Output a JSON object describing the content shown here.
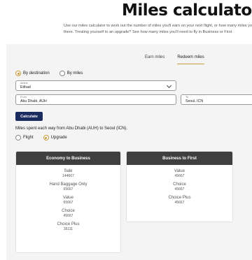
{
  "header": {
    "title": "Miles calculator",
    "intro_line1": "Use our miles calculator to work out the number of miles you'll earn on your next flight, or how many miles you'll need to",
    "intro_line2": "there. Treating yourself to an upgrade? See how many miles you'll need to fly in Business or First"
  },
  "tabs": [
    {
      "label": "Earn miles",
      "active": false
    },
    {
      "label": "Redeem miles",
      "active": true
    }
  ],
  "search_mode": {
    "options": [
      "By destination",
      "By miles"
    ],
    "selected": "By destination"
  },
  "airline": {
    "label": "Airline",
    "value": "Etihad"
  },
  "from": {
    "label": "From",
    "value": "Abu Dhabi, AUH"
  },
  "to": {
    "label": "To",
    "value": "Seoul, ICN"
  },
  "calculate_label": "Calculate",
  "result_text": "Miles spent each way from Abu Dhabi (AUH) to Seoul (ICN).",
  "redeem_type": {
    "options": [
      "Flight",
      "Upgrade"
    ],
    "selected": "Upgrade"
  },
  "cards": [
    {
      "title": "Economy to Business",
      "rows": [
        {
          "label": "Sale",
          "value": "144667"
        },
        {
          "label": "Hand Baggage Only",
          "value": "65667"
        },
        {
          "label": "Value",
          "value": "65667"
        },
        {
          "label": "Choice",
          "value": "45667"
        },
        {
          "label": "Choice Plus",
          "value": "35111"
        }
      ]
    },
    {
      "title": "Business to First",
      "rows": [
        {
          "label": "Value",
          "value": "45667"
        },
        {
          "label": "Choice",
          "value": "45667"
        },
        {
          "label": "Choice Plus",
          "value": "45667"
        }
      ]
    }
  ],
  "colors": {
    "accent": "#c99a3b",
    "button": "#1a2b5e",
    "card_header": "#3f3f3f"
  }
}
